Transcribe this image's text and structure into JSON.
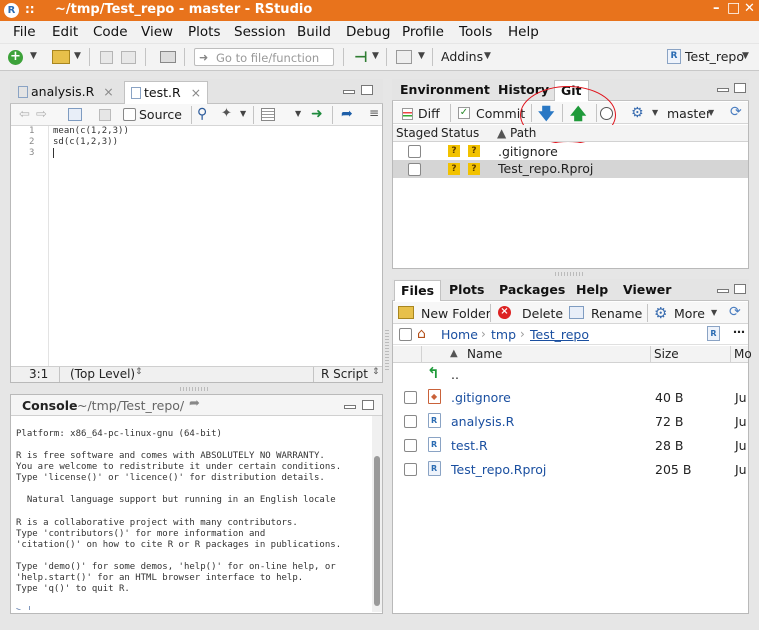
{
  "window": {
    "title": "~/tmp/Test_repo - master - RStudio",
    "app_icon": "R",
    "grip": "::"
  },
  "menu": [
    "File",
    "Edit",
    "Code",
    "View",
    "Plots",
    "Session",
    "Build",
    "Debug",
    "Profile",
    "Tools",
    "Help"
  ],
  "toolbar": {
    "goto_placeholder": "Go to file/function",
    "addins": "Addins",
    "project": "Test_repo"
  },
  "editor": {
    "tabs": [
      {
        "label": "analysis.R"
      },
      {
        "label": "test.R"
      }
    ],
    "source_label": "Source",
    "lines": [
      {
        "num": "1",
        "code": "mean(c(1,2,3))"
      },
      {
        "num": "2",
        "code": "sd(c(1,2,3))"
      },
      {
        "num": "3",
        "code": ""
      }
    ],
    "status": {
      "position": "3:1",
      "scope": "(Top Level)",
      "filetype": "R Script"
    }
  },
  "console": {
    "title": "Console",
    "path": "~/tmp/Test_repo/",
    "lines": [
      "Platform: x86_64-pc-linux-gnu (64-bit)",
      "",
      "R is free software and comes with ABSOLUTELY NO WARRANTY.",
      "You are welcome to redistribute it under certain conditions.",
      "Type 'license()' or 'licence()' for distribution details.",
      "",
      "  Natural language support but running in an English locale",
      "",
      "R is a collaborative project with many contributors.",
      "Type 'contributors()' for more information and",
      "'citation()' on how to cite R or R packages in publications.",
      "",
      "Type 'demo()' for some demos, 'help()' for on-line help, or",
      "'help.start()' for an HTML browser interface to help.",
      "Type 'q()' to quit R.",
      "",
      "> |"
    ]
  },
  "env_pane": {
    "tabs": [
      "Environment",
      "History",
      "Git"
    ],
    "diff": "Diff",
    "commit": "Commit",
    "branch": "master",
    "columns": [
      "Staged",
      "Status",
      "Path"
    ],
    "status_badge": "?",
    "files": [
      {
        "path": ".gitignore",
        "selected": false
      },
      {
        "path": "Test_repo.Rproj",
        "selected": true
      }
    ],
    "annotation_color": "#e0121b"
  },
  "files_pane": {
    "tabs": [
      "Files",
      "Plots",
      "Packages",
      "Help",
      "Viewer"
    ],
    "actions": {
      "new_folder": "New Folder",
      "delete": "Delete",
      "rename": "Rename",
      "more": "More"
    },
    "breadcrumb": [
      "Home",
      "tmp",
      "Test_repo"
    ],
    "columns": [
      "Name",
      "Size",
      "Mo"
    ],
    "up": "..",
    "files": [
      {
        "name": ".gitignore",
        "size": "40 B",
        "mod": "Ju",
        "icon": "git-file-icon"
      },
      {
        "name": "analysis.R",
        "size": "72 B",
        "mod": "Ju",
        "icon": "r-file-icon"
      },
      {
        "name": "test.R",
        "size": "28 B",
        "mod": "Ju",
        "icon": "r-file-icon"
      },
      {
        "name": "Test_repo.Rproj",
        "size": "205 B",
        "mod": "Ju",
        "icon": "rproj-file-icon"
      }
    ]
  }
}
